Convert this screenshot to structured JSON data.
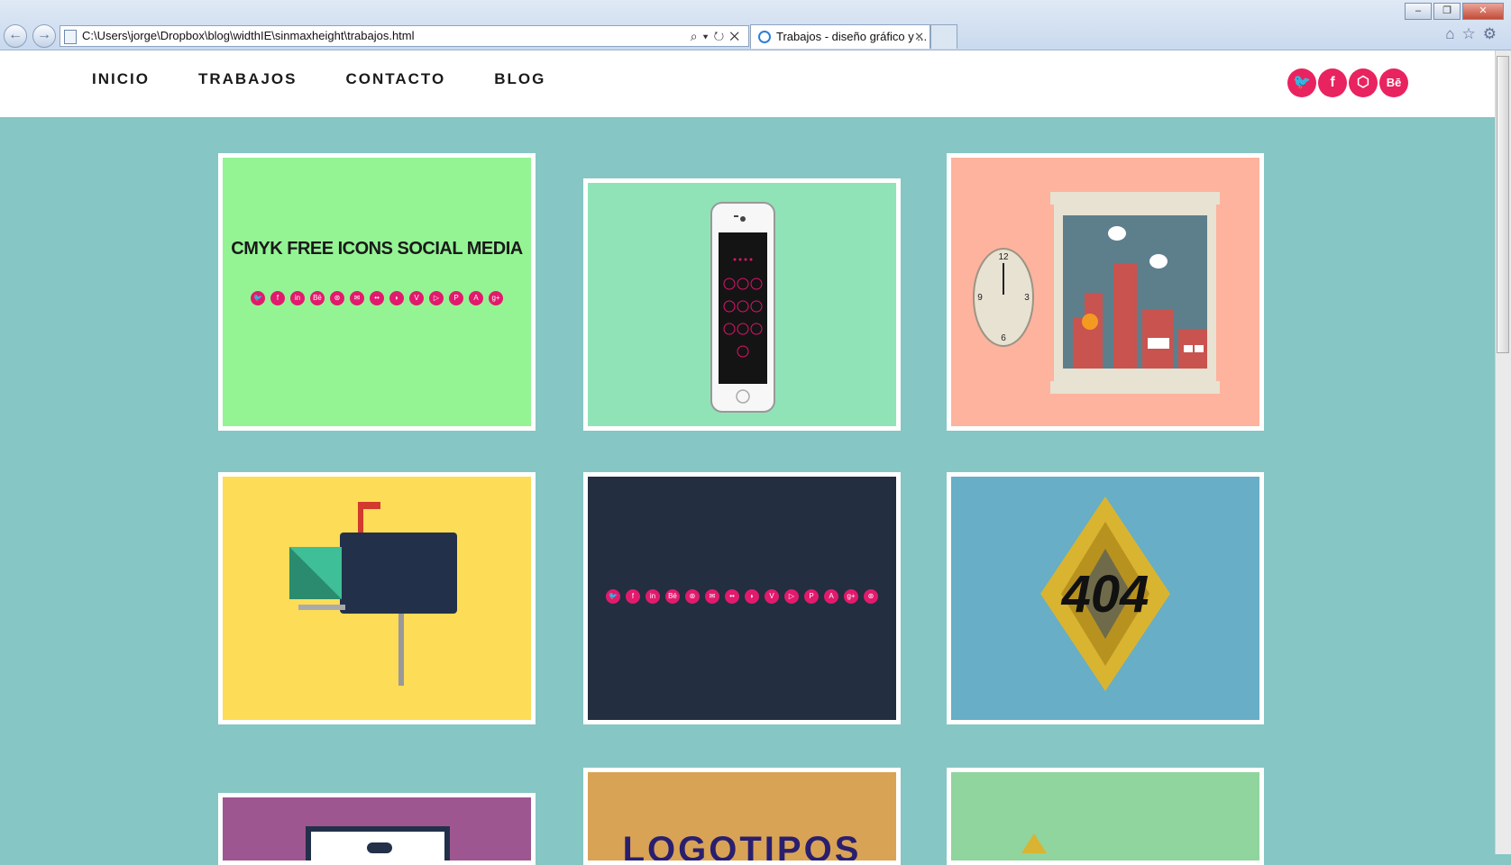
{
  "browser": {
    "address": "C:\\Users\\jorge\\Dropbox\\blog\\widthIE\\sinmaxheight\\trabajos.html",
    "tab_title": "Trabajos - diseño gráfico y ...",
    "back": "←",
    "forward": "→",
    "address_tools": "⌕▾↻✕",
    "tab_close": "✕",
    "window_buttons": [
      "–",
      "❐",
      "✕"
    ],
    "right_tools": [
      "⌂",
      "☆",
      "⚙"
    ]
  },
  "nav": {
    "items": [
      "INICIO",
      "TRABAJOS",
      "CONTACTO",
      "BLOG"
    ]
  },
  "social": [
    {
      "icon": "twitter-icon",
      "glyph": "🐦"
    },
    {
      "icon": "facebook-icon",
      "glyph": "f"
    },
    {
      "icon": "codepen-icon",
      "glyph": "⬡"
    },
    {
      "icon": "behance-icon",
      "glyph": "Bē"
    }
  ],
  "works": {
    "card1_title": "CMYK FREE ICONS SOCIAL MEDIA",
    "card6_text": "404",
    "card8_text": "LOGOTIPOS",
    "clock": {
      "n12": "12",
      "n3": "3",
      "n6": "6",
      "n9": "9"
    },
    "icon_glyphs": [
      "🐦",
      "f",
      "in",
      "Bē",
      "⊛",
      "✉",
      "••",
      "◗",
      "V",
      "▷",
      "P",
      "A",
      "g+"
    ],
    "icon_glyphs_dark": [
      "🐦",
      "f",
      "in",
      "Bē",
      "⊛",
      "✉",
      "••",
      "◗",
      "V",
      "▷",
      "P",
      "A",
      "g+",
      "⊛"
    ]
  },
  "colors": {
    "page_bg": "#86c6c4",
    "accent": "#e9235f",
    "card1": "#94f494",
    "card2": "#90e3b6",
    "card3": "#fdb39e",
    "card4": "#fddc58",
    "card5": "#232e40",
    "card6": "#67aec6",
    "card7": "#9e5690",
    "card8": "#d9a356",
    "card9": "#90d49e"
  }
}
